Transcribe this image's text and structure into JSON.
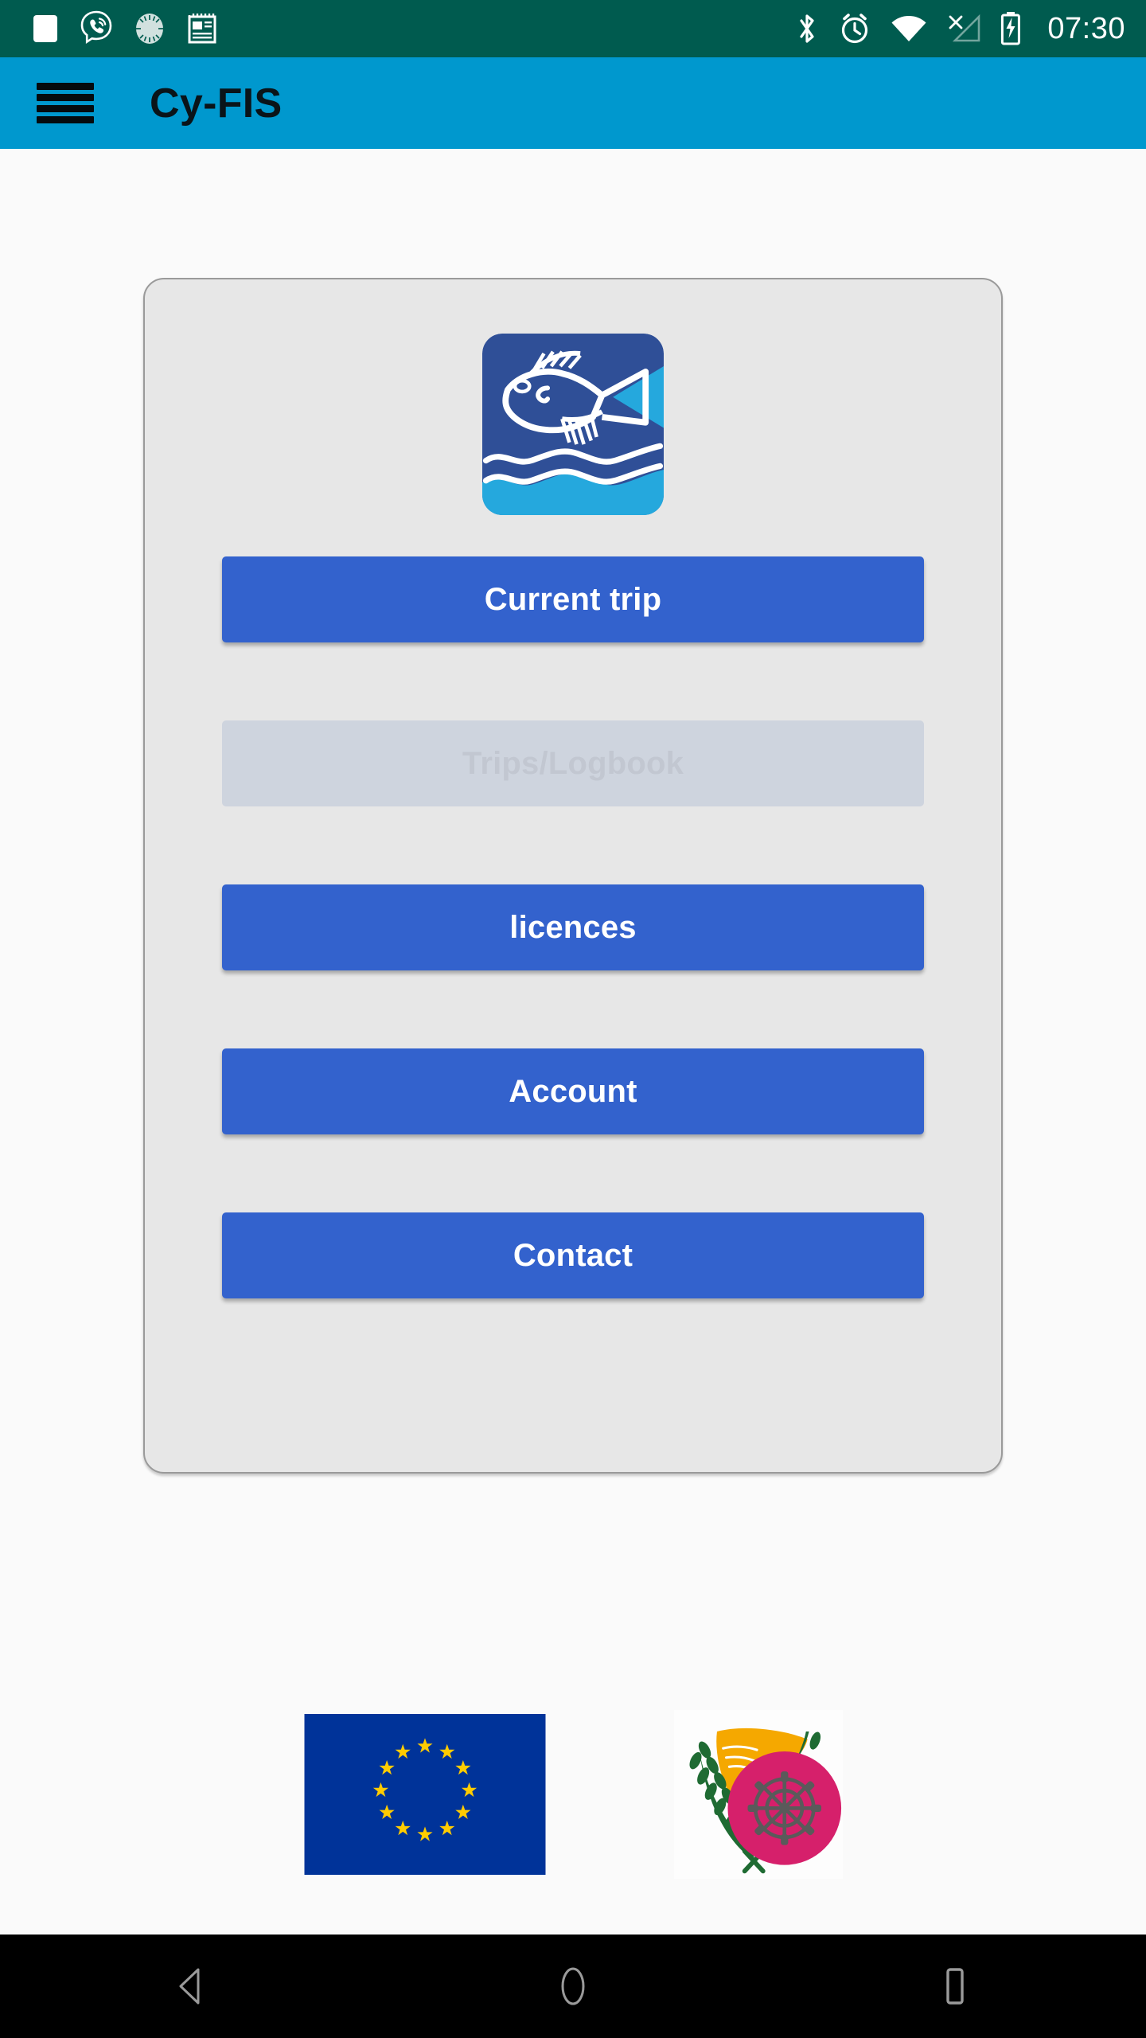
{
  "status_bar": {
    "background_color": "#005b4f",
    "time": "07:30",
    "notification_icons": [
      {
        "name": "blank-notification-icon",
        "label": "notification"
      },
      {
        "name": "viber-icon",
        "label": "Viber"
      },
      {
        "name": "sync-spinner-icon",
        "label": "syncing"
      },
      {
        "name": "news-document-icon",
        "label": "news"
      }
    ],
    "system_icons": [
      {
        "name": "bluetooth-icon",
        "label": "Bluetooth"
      },
      {
        "name": "alarm-clock-icon",
        "label": "Alarm"
      },
      {
        "name": "wifi-icon",
        "label": "Wi-Fi"
      },
      {
        "name": "no-mobile-signal-icon",
        "label": "No signal"
      },
      {
        "name": "battery-charging-icon",
        "label": "Charging"
      }
    ]
  },
  "app_bar": {
    "background_color": "#0098ce",
    "title": "Cy-FIS",
    "menu_icon": "hamburger-menu-icon"
  },
  "main": {
    "logo": {
      "name": "cyfis-fish-logo",
      "background_color": "#2f4f97",
      "wave_color": "#25a8dd"
    },
    "buttons": [
      {
        "label": "Current trip",
        "state": "enabled",
        "name": "current-trip-button"
      },
      {
        "label": "Trips/Logbook",
        "state": "disabled",
        "name": "trips-logbook-button"
      },
      {
        "label": "licences",
        "state": "enabled",
        "name": "licences-button"
      },
      {
        "label": "Account",
        "state": "enabled",
        "name": "account-button"
      },
      {
        "label": "Contact",
        "state": "enabled",
        "name": "contact-button"
      }
    ],
    "button_colors": {
      "enabled_background": "#3362cd",
      "enabled_text": "#ffffff",
      "disabled_background": "#ced4de",
      "disabled_text": "#c2c7d1"
    },
    "card": {
      "background_color": "#e7e7e7",
      "border_color": "#9a9a9a"
    }
  },
  "footer": {
    "logos": [
      {
        "name": "european-union-flag",
        "label": "European Union",
        "stars": 12,
        "field_color": "#039",
        "star_color": "#ffcc00"
      },
      {
        "name": "cyprus-republic-emblem",
        "label": "Republic of Cyprus",
        "island_color": "#f5a800",
        "branch_color": "#1f6b33",
        "badge_color": "#d6206b"
      }
    ]
  },
  "nav_bar": {
    "background_color": "#000000",
    "buttons": [
      {
        "name": "nav-back-button",
        "label": "Back"
      },
      {
        "name": "nav-home-button",
        "label": "Home"
      },
      {
        "name": "nav-recents-button",
        "label": "Recents"
      }
    ]
  }
}
